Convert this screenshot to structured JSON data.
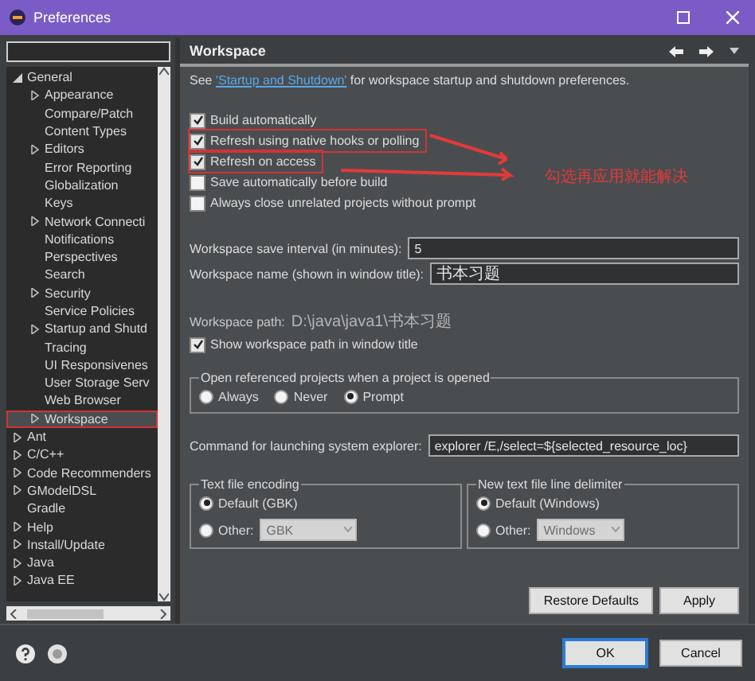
{
  "window": {
    "title": "Preferences"
  },
  "tree": [
    {
      "label": "General",
      "expanded": true,
      "highlighted": false,
      "selected": false,
      "children": [
        {
          "label": "Appearance",
          "expanded": false,
          "highlighted": false,
          "selected": false
        },
        {
          "label": "Compare/Patch",
          "highlighted": false,
          "selected": false
        },
        {
          "label": "Content Types",
          "highlighted": false,
          "selected": false
        },
        {
          "label": "Editors",
          "expanded": false,
          "highlighted": false,
          "selected": false
        },
        {
          "label": "Error Reporting",
          "highlighted": false,
          "selected": false
        },
        {
          "label": "Globalization",
          "highlighted": false,
          "selected": false
        },
        {
          "label": "Keys",
          "highlighted": false,
          "selected": false
        },
        {
          "label": "Network Connecti",
          "expanded": false,
          "highlighted": false,
          "selected": false
        },
        {
          "label": "Notifications",
          "highlighted": false,
          "selected": false
        },
        {
          "label": "Perspectives",
          "highlighted": false,
          "selected": false
        },
        {
          "label": "Search",
          "highlighted": false,
          "selected": false
        },
        {
          "label": "Security",
          "expanded": false,
          "highlighted": false,
          "selected": false
        },
        {
          "label": "Service Policies",
          "highlighted": false,
          "selected": false
        },
        {
          "label": "Startup and Shutd",
          "expanded": false,
          "highlighted": false,
          "selected": false
        },
        {
          "label": "Tracing",
          "highlighted": false,
          "selected": false
        },
        {
          "label": "UI Responsivenes",
          "highlighted": false,
          "selected": false
        },
        {
          "label": "User Storage Serv",
          "highlighted": false,
          "selected": false
        },
        {
          "label": "Web Browser",
          "highlighted": false,
          "selected": false
        },
        {
          "label": "Workspace",
          "expanded": false,
          "highlighted": true,
          "selected": true
        }
      ]
    },
    {
      "label": "Ant",
      "expanded": false,
      "highlighted": false,
      "selected": false
    },
    {
      "label": "C/C++",
      "expanded": false,
      "highlighted": false,
      "selected": false
    },
    {
      "label": "Code Recommenders",
      "expanded": false,
      "highlighted": false,
      "selected": false
    },
    {
      "label": "GModelDSL",
      "expanded": false,
      "highlighted": false,
      "selected": false
    },
    {
      "label": "Gradle",
      "highlighted": false,
      "selected": false
    },
    {
      "label": "Help",
      "expanded": false,
      "highlighted": false,
      "selected": false
    },
    {
      "label": "Install/Update",
      "expanded": false,
      "highlighted": false,
      "selected": false
    },
    {
      "label": "Java",
      "expanded": false,
      "highlighted": false,
      "selected": false
    },
    {
      "label": "Java EE",
      "expanded": false,
      "highlighted": false,
      "selected": false
    }
  ],
  "page": {
    "title": "Workspace",
    "intro": {
      "before": "See ",
      "link": "'Startup and Shutdown'",
      "after": " for workspace startup and shutdown preferences."
    },
    "options": [
      {
        "label": "Build automatically",
        "checked": true,
        "highlighted": false
      },
      {
        "label": "Refresh using native hooks or polling",
        "checked": true,
        "highlighted": true
      },
      {
        "label": "Refresh on access",
        "checked": true,
        "highlighted": true
      },
      {
        "label": "Save automatically before build",
        "checked": false,
        "highlighted": false
      },
      {
        "label": "Always close unrelated projects without prompt",
        "checked": false,
        "highlighted": false
      }
    ],
    "fields": [
      {
        "label": "Workspace save interval (in minutes):",
        "value": "5"
      },
      {
        "label": "Workspace name (shown in window title):",
        "value": "书本习题"
      }
    ],
    "path": {
      "label": "Workspace path:",
      "value": "D:\\java\\java1\\书本习题"
    },
    "show_path": {
      "label": "Show workspace path in window title",
      "checked": true
    },
    "open_projects": {
      "title": "Open referenced projects when a project is opened",
      "choices": [
        {
          "label": "Always",
          "selected": false
        },
        {
          "label": "Never",
          "selected": false
        },
        {
          "label": "Prompt",
          "selected": true
        }
      ]
    },
    "explorer": {
      "label": "Command for launching system explorer:",
      "value": "explorer /E,/select=${selected_resource_loc}"
    },
    "encoding": {
      "title": "Text file encoding",
      "choices": [
        {
          "label": "Default (GBK)",
          "selected": true
        },
        {
          "label": "Other:",
          "selected": false
        }
      ],
      "other_value": "GBK"
    },
    "delimiter": {
      "title": "New text file line delimiter",
      "choices": [
        {
          "label": "Default (Windows)",
          "selected": true
        },
        {
          "label": "Other:",
          "selected": false
        }
      ],
      "other_value": "Windows"
    },
    "buttons": [
      "Restore Defaults",
      "Apply"
    ]
  },
  "annotation": {
    "note": "勾选再应用就能解决"
  },
  "dialog_buttons": [
    {
      "label": "OK",
      "default": true
    },
    {
      "label": "Cancel",
      "default": false
    }
  ]
}
